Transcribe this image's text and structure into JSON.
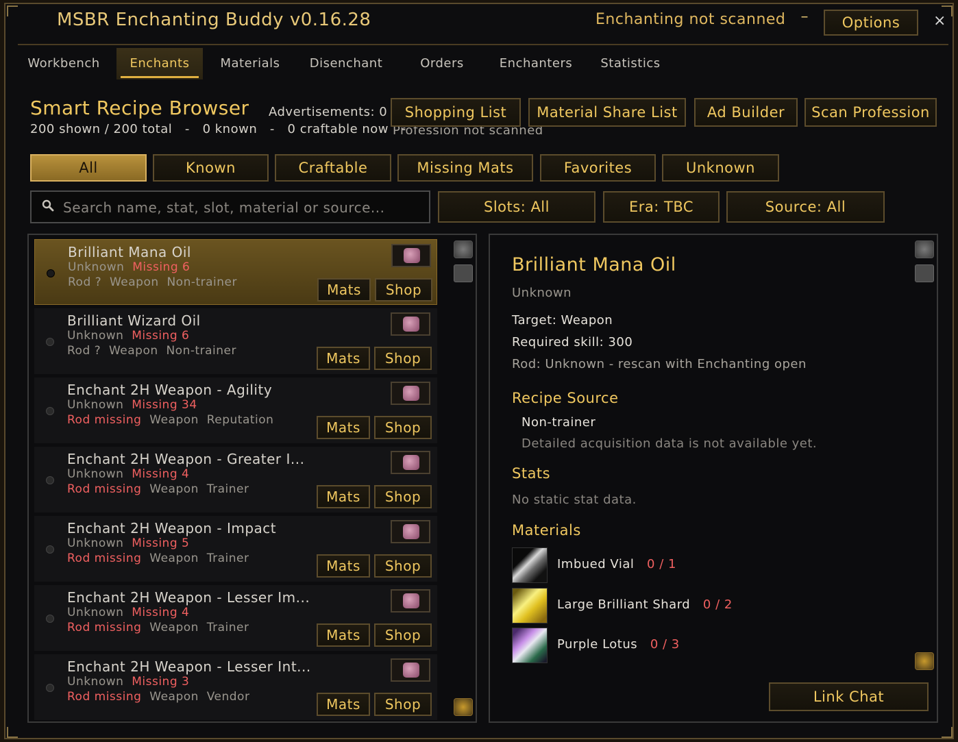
{
  "app": {
    "title": "MSBR Enchanting Buddy v0.16.28",
    "status": "Enchanting not scanned",
    "minimize_label": "–",
    "options_label": "Options",
    "close_label": "×"
  },
  "tabs": [
    {
      "label": "Workbench"
    },
    {
      "label": "Enchants"
    },
    {
      "label": "Materials"
    },
    {
      "label": "Disenchant"
    },
    {
      "label": "Orders"
    },
    {
      "label": "Enchanters"
    },
    {
      "label": "Statistics"
    }
  ],
  "header": {
    "title": "Smart Recipe Browser",
    "summary": "200 shown / 200 total   -   0 known   -   0 craftable now   -",
    "profession_status": "Profession not scanned",
    "advertisements": "Advertisements: 0",
    "shopping_list": "Shopping List",
    "material_share_list": "Material Share List",
    "ad_builder": "Ad Builder",
    "scan_profession": "Scan Profession"
  },
  "filters": [
    {
      "label": "All",
      "active": true
    },
    {
      "label": "Known"
    },
    {
      "label": "Craftable"
    },
    {
      "label": "Missing Mats"
    },
    {
      "label": "Favorites"
    },
    {
      "label": "Unknown"
    }
  ],
  "search": {
    "placeholder": "Search name, stat, slot, material or source..."
  },
  "dropdowns": {
    "slots": "Slots: All",
    "era": "Era: TBC",
    "source": "Source: All"
  },
  "recipes": [
    {
      "name": "Brilliant Mana Oil",
      "status": "Unknown",
      "missing": "Missing 6",
      "rod": "Rod ?",
      "rod_missing": false,
      "slot": "Weapon",
      "source": "Non-trainer",
      "mats": "Mats",
      "shop": "Shop"
    },
    {
      "name": "Brilliant Wizard Oil",
      "status": "Unknown",
      "missing": "Missing 6",
      "rod": "Rod ?",
      "rod_missing": false,
      "slot": "Weapon",
      "source": "Non-trainer",
      "mats": "Mats",
      "shop": "Shop"
    },
    {
      "name": "Enchant 2H Weapon - Agility",
      "status": "Unknown",
      "missing": "Missing 34",
      "rod": "Rod missing",
      "rod_missing": true,
      "slot": "Weapon",
      "source": "Reputation",
      "mats": "Mats",
      "shop": "Shop"
    },
    {
      "name": "Enchant 2H Weapon - Greater I...",
      "status": "Unknown",
      "missing": "Missing 4",
      "rod": "Rod missing",
      "rod_missing": true,
      "slot": "Weapon",
      "source": "Trainer",
      "mats": "Mats",
      "shop": "Shop"
    },
    {
      "name": "Enchant 2H Weapon - Impact",
      "status": "Unknown",
      "missing": "Missing 5",
      "rod": "Rod missing",
      "rod_missing": true,
      "slot": "Weapon",
      "source": "Trainer",
      "mats": "Mats",
      "shop": "Shop"
    },
    {
      "name": "Enchant 2H Weapon - Lesser Im...",
      "status": "Unknown",
      "missing": "Missing 4",
      "rod": "Rod missing",
      "rod_missing": true,
      "slot": "Weapon",
      "source": "Trainer",
      "mats": "Mats",
      "shop": "Shop"
    },
    {
      "name": "Enchant 2H Weapon - Lesser Int...",
      "status": "Unknown",
      "missing": "Missing 3",
      "rod": "Rod missing",
      "rod_missing": true,
      "slot": "Weapon",
      "source": "Vendor",
      "mats": "Mats",
      "shop": "Shop"
    }
  ],
  "detail": {
    "title": "Brilliant Mana Oil",
    "status": "Unknown",
    "target": "Target: Weapon",
    "required_skill": "Required skill: 300",
    "rod": "Rod: Unknown - rescan with Enchanting open",
    "recipe_source_head": "Recipe Source",
    "recipe_source": "Non-trainer",
    "recipe_source_note": "Detailed acquisition data is not available yet.",
    "stats_head": "Stats",
    "stats_note": "No static stat data.",
    "materials_head": "Materials",
    "materials": [
      {
        "name": "Imbued Vial",
        "count": "0 / 1",
        "icon": "imbued-vial-icon"
      },
      {
        "name": "Large Brilliant Shard",
        "count": "0 / 2",
        "icon": "large-brilliant-shard-icon"
      },
      {
        "name": "Purple Lotus",
        "count": "0 / 3",
        "icon": "purple-lotus-icon"
      }
    ],
    "link_chat": "Link Chat"
  },
  "colors": {
    "gold": "#f0c860",
    "missing_red": "#f06060",
    "selected_row": "#6a5420"
  }
}
